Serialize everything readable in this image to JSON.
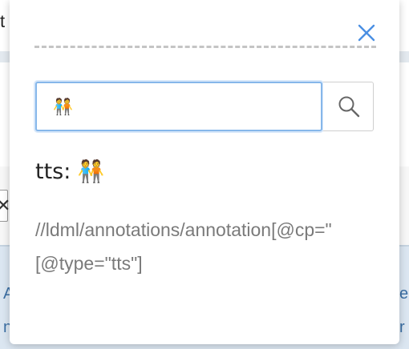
{
  "background": {
    "title_fragment": "t",
    "close_fragment": "✕",
    "link_fragments": [
      "A",
      "n",
      "e",
      "r"
    ]
  },
  "popover": {
    "close_icon": "close-icon",
    "search": {
      "value": "🧑‍🤝‍🧑",
      "placeholder": "",
      "button_icon": "search-icon"
    },
    "tts_label": "tts: 🧑‍🤝‍🧑",
    "xpath_line1": "//ldml/annotations/annotation[@cp=\"",
    "xpath_line2": "[@type=\"tts\"]"
  },
  "colors": {
    "accent": "#4a8fe3",
    "input_border": "#86b7ea",
    "path_text": "#7a7a7a"
  }
}
